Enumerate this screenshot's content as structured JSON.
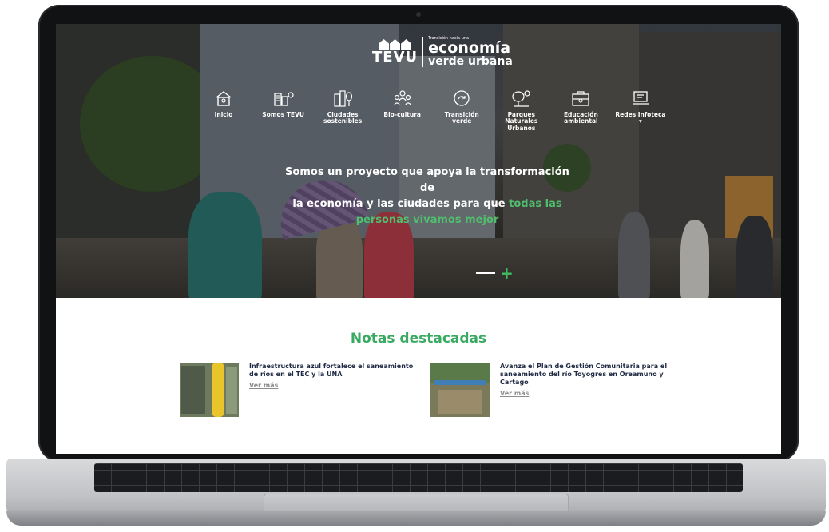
{
  "logo": {
    "mark": "TEVU",
    "tagline_small": "Transición hacia una",
    "tagline_big": "economía",
    "tagline_mid": "verde urbana"
  },
  "nav": [
    {
      "label": "Inicio",
      "icon": "home-icon"
    },
    {
      "label": "Somos TEVU",
      "icon": "buildings-icon"
    },
    {
      "label": "Ciudades sostenibles",
      "icon": "city-tree-icon"
    },
    {
      "label": "Bio-cultura",
      "icon": "people-icon"
    },
    {
      "label": "Transición verde",
      "icon": "recycle-icon"
    },
    {
      "label": "Parques Naturales Urbanos",
      "icon": "park-icon"
    },
    {
      "label": "Educación ambiental",
      "icon": "education-icon"
    },
    {
      "label": "Redes Infoteca ▾",
      "icon": "network-icon"
    }
  ],
  "hero": {
    "line1": "Somos un proyecto que apoya la transformación de",
    "line2_a": "la economía y las ciudades para que ",
    "line2_b": "todas las",
    "line3": "personas vivamos mejor"
  },
  "slider": {
    "plus": "+"
  },
  "notes": {
    "title": "Notas destacadas",
    "items": [
      {
        "title": "Infraestructura azul fortalece el saneamiento de ríos en el TEC y la UNA",
        "link": "Ver más"
      },
      {
        "title": "Avanza el Plan de Gestión Comunitaria para el saneamiento del río Toyogres en Oreamuno y Cartago",
        "link": "Ver más"
      }
    ]
  },
  "colors": {
    "accent_green": "#3aaa62",
    "note_title": "#1f2a44",
    "link_gray": "#8c8c8c"
  }
}
